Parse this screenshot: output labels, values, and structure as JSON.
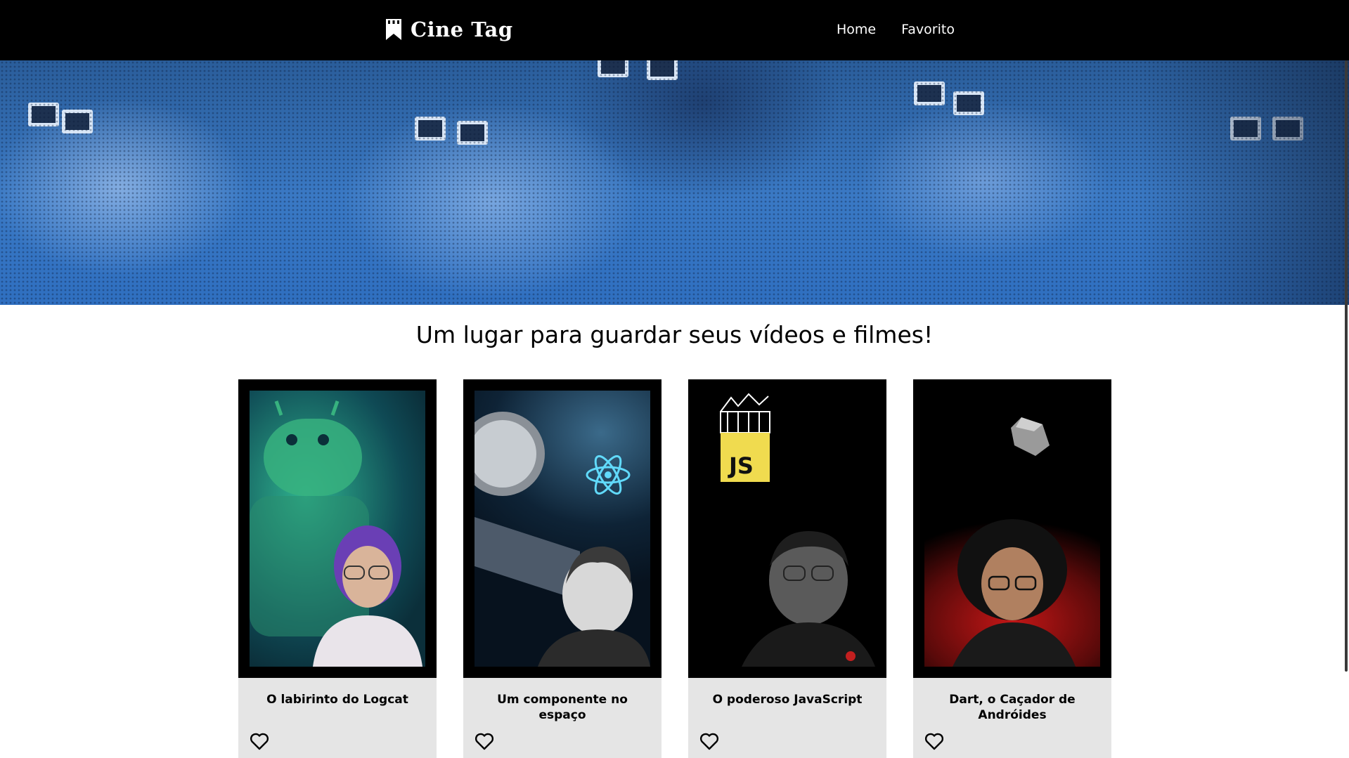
{
  "header": {
    "logo_text": "Cine Tag",
    "nav": [
      {
        "label": "Home"
      },
      {
        "label": "Favorito"
      }
    ]
  },
  "banner": {
    "image": "audience-3d-glasses-blue-halftone"
  },
  "headline": "Um lugar para guardar seus vídeos e filmes!",
  "cards": [
    {
      "title": "O labirinto do Logcat",
      "thumb": "android-logcat",
      "icon": "heart-outline-icon"
    },
    {
      "title": "Um componente no espaço",
      "thumb": "react-space-satellite",
      "icon": "heart-outline-icon"
    },
    {
      "title": "O poderoso JavaScript",
      "thumb": "javascript-logo",
      "icon": "heart-outline-icon",
      "logo_text": "JS"
    },
    {
      "title": "Dart, o Caçador de Andróides",
      "thumb": "dart-red-smoke",
      "icon": "heart-outline-icon"
    }
  ],
  "colors": {
    "header_bg": "#000000",
    "banner_blue": "#3a79c4",
    "card_bg": "#e5e5e5",
    "js_yellow": "#f0db4f",
    "react_cyan": "#61dafb"
  }
}
